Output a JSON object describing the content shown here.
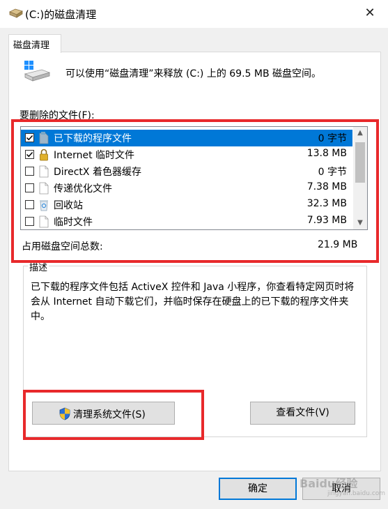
{
  "window": {
    "title": "(C:)的磁盘清理",
    "close_glyph": "✕"
  },
  "tabs": [
    {
      "label": "磁盘清理"
    }
  ],
  "info_text": "可以使用“磁盘清理”来释放  (C:) 上的 69.5 MB 磁盘空间。",
  "files_label": "要删除的文件(F):",
  "files": [
    {
      "name": "已下载的程序文件",
      "size": "0 字节",
      "checked": true,
      "selected": true,
      "icon": "folder-icon"
    },
    {
      "name": "Internet 临时文件",
      "size": "13.8 MB",
      "checked": true,
      "selected": false,
      "icon": "lock-icon"
    },
    {
      "name": "DirectX 着色器缓存",
      "size": "0 字节",
      "checked": false,
      "selected": false,
      "icon": "file-icon"
    },
    {
      "name": "传递优化文件",
      "size": "7.38 MB",
      "checked": false,
      "selected": false,
      "icon": "file-icon"
    },
    {
      "name": "回收站",
      "size": "32.3 MB",
      "checked": false,
      "selected": false,
      "icon": "recycle-bin-icon"
    },
    {
      "name": "临时文件",
      "size": "7.93 MB",
      "checked": false,
      "selected": false,
      "icon": "file-icon"
    }
  ],
  "scroll": {
    "up": "▲",
    "down": "▼"
  },
  "total": {
    "label": "占用磁盘空间总数:",
    "value": "21.9 MB"
  },
  "description": {
    "label": "描述",
    "text": "已下载的程序文件包括 ActiveX 控件和 Java 小程序，你查看特定网页时将会从 Internet 自动下载它们，并临时保存在硬盘上的已下载的程序文件夹中。"
  },
  "buttons": {
    "clean_system": "清理系统文件(S)",
    "view_files": "查看文件(V)",
    "ok": "确定",
    "cancel": "取消"
  },
  "watermark": {
    "text": "Baidu经验",
    "sub": "jingyan.baidu.com"
  },
  "colors": {
    "highlight": "#e8292b",
    "selection": "#0078d7"
  }
}
